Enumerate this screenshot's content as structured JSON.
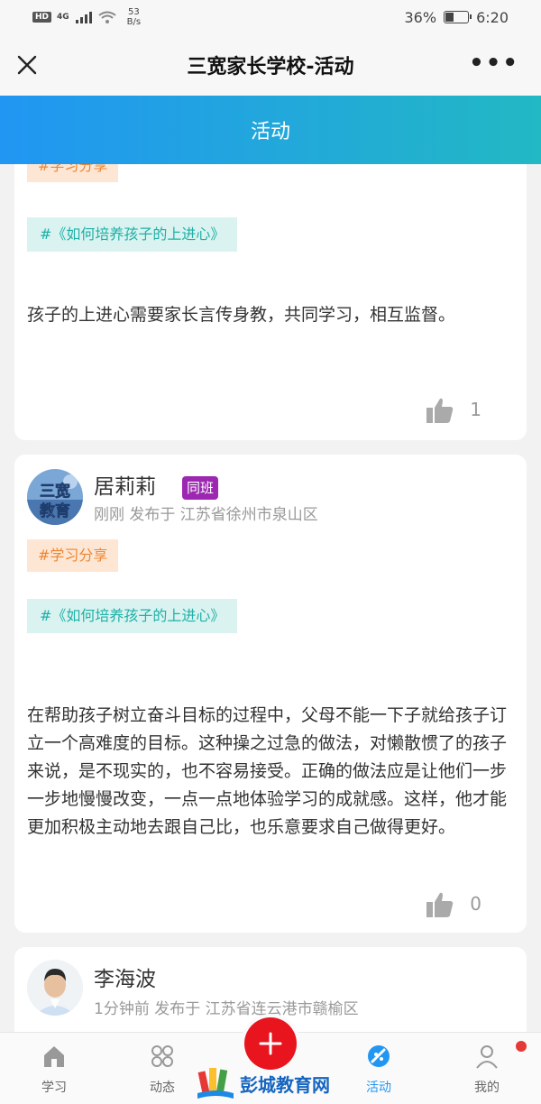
{
  "status_bar": {
    "hd_label": "HD",
    "network_label": "4G",
    "net_speed_value": "53",
    "net_speed_unit": "B/s",
    "battery_percent": "36%",
    "battery_level": 0.36,
    "time": "6:20"
  },
  "title_bar": {
    "title": "三宽家长学校-活动",
    "more_label": "•••"
  },
  "header": {
    "title": "活动"
  },
  "posts": [
    {
      "category_tag": "#学习分享",
      "topic_tag": "#《如何培养孩子的上进心》",
      "content": "孩子的上进心需要家长言传身教，共同学习，相互监督。",
      "likes": "1"
    },
    {
      "author": "居莉莉",
      "badge": "同班",
      "avatar_text": "三宽教育",
      "meta": "刚刚  发布于  江苏省徐州市泉山区",
      "category_tag": "#学习分享",
      "topic_tag": "#《如何培养孩子的上进心》",
      "content": "在帮助孩子树立奋斗目标的过程中，父母不能一下子就给孩子订立一个高难度的目标。这种操之过急的做法，对懒散惯了的孩子来说，是不现实的，也不容易接受。正确的做法应是让他们一步一步地慢慢改变，一点一点地体验学习的成就感。这样，他才能更加积极主动地去跟自己比，也乐意要求自己做得更好。",
      "likes": "0"
    },
    {
      "author": "李海波",
      "meta": "1分钟前  发布于  江苏省连云港市赣榆区"
    }
  ],
  "tabbar": {
    "tabs": [
      {
        "label": "学习",
        "icon": "home-icon"
      },
      {
        "label": "动态",
        "icon": "grid-circles-icon"
      },
      {
        "label": "活动",
        "icon": "activity-icon"
      },
      {
        "label": "我的",
        "icon": "user-icon"
      }
    ],
    "fab_icon": "plus-icon"
  },
  "watermark": {
    "text": "彭城教育网",
    "logo": "books-logo"
  },
  "colors": {
    "header_gradient_start": "#2196f3",
    "header_gradient_end": "#22b8c4",
    "tag_orange_bg": "#fde7d4",
    "tag_orange_text": "#ef8532",
    "tag_teal_bg": "#daf3f1",
    "tag_teal_text": "#1fb0a6",
    "badge_purple": "#9c27b0",
    "fab_red": "#e8141e",
    "active_tab": "#2196f3"
  }
}
